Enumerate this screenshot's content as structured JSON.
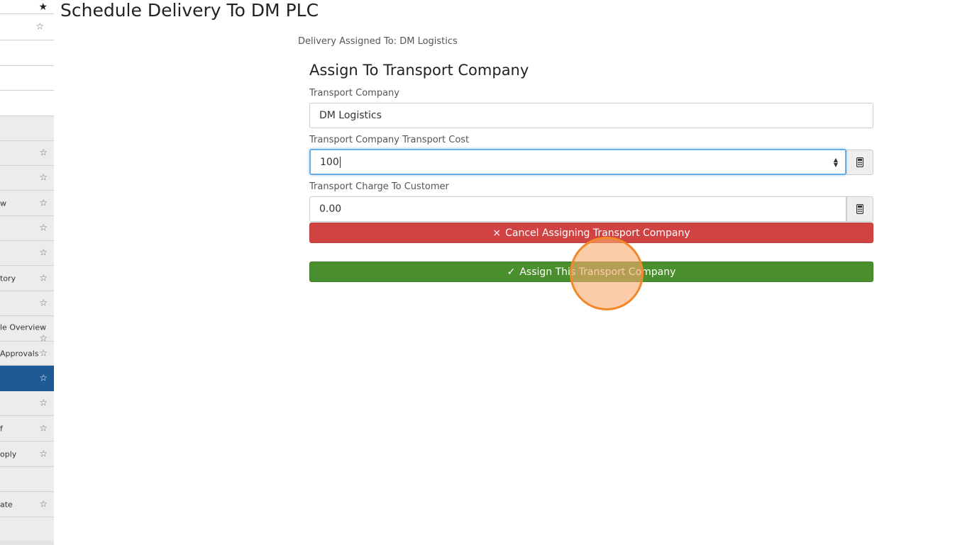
{
  "page_title": "Schedule Delivery To DM PLC",
  "delivery_assigned": "Delivery Assigned To: DM Logistics",
  "form": {
    "title": "Assign To Transport Company",
    "transport_company": {
      "label": "Transport Company",
      "value": "DM Logistics"
    },
    "transport_cost": {
      "label": "Transport Company Transport Cost",
      "value": "100"
    },
    "charge_to_customer": {
      "label": "Transport Charge To Customer",
      "value": "0.00"
    },
    "cancel_button": "Cancel Assigning Transport Company",
    "assign_button": "Assign This Transport Company"
  },
  "sidebar": {
    "items": [
      {
        "label": "",
        "star": "solid"
      },
      {
        "label": "",
        "star": "outline"
      },
      {
        "label": "",
        "star": ""
      },
      {
        "label": "",
        "star": ""
      },
      {
        "label": "",
        "star": ""
      },
      {
        "label": "",
        "star": ""
      },
      {
        "label": "",
        "star": "outline"
      },
      {
        "label": "",
        "star": "outline"
      },
      {
        "label": "w",
        "star": "outline"
      },
      {
        "label": "",
        "star": "outline"
      },
      {
        "label": "",
        "star": "outline"
      },
      {
        "label": "tory",
        "star": "outline"
      },
      {
        "label": "",
        "star": "outline"
      },
      {
        "label": "le Overview",
        "star": "outline"
      },
      {
        "label": "Approvals",
        "star": "outline"
      },
      {
        "label": "",
        "star": "outline"
      },
      {
        "label": "",
        "star": "outline"
      },
      {
        "label": "f",
        "star": "outline"
      },
      {
        "label": "oply",
        "star": "outline"
      },
      {
        "label": "",
        "star": ""
      },
      {
        "label": "ate",
        "star": "outline"
      },
      {
        "label": "",
        "star": ""
      }
    ]
  },
  "icons": {
    "star_outline": "☆",
    "star_solid": "★",
    "calculator": "calculator-icon",
    "check": "✓",
    "times": "×"
  },
  "colors": {
    "active_sidebar": "#1e5a96",
    "danger": "#d14343",
    "success": "#4a8f2d",
    "focus_border": "#66afe9",
    "click_indicator": "#f3882a"
  }
}
